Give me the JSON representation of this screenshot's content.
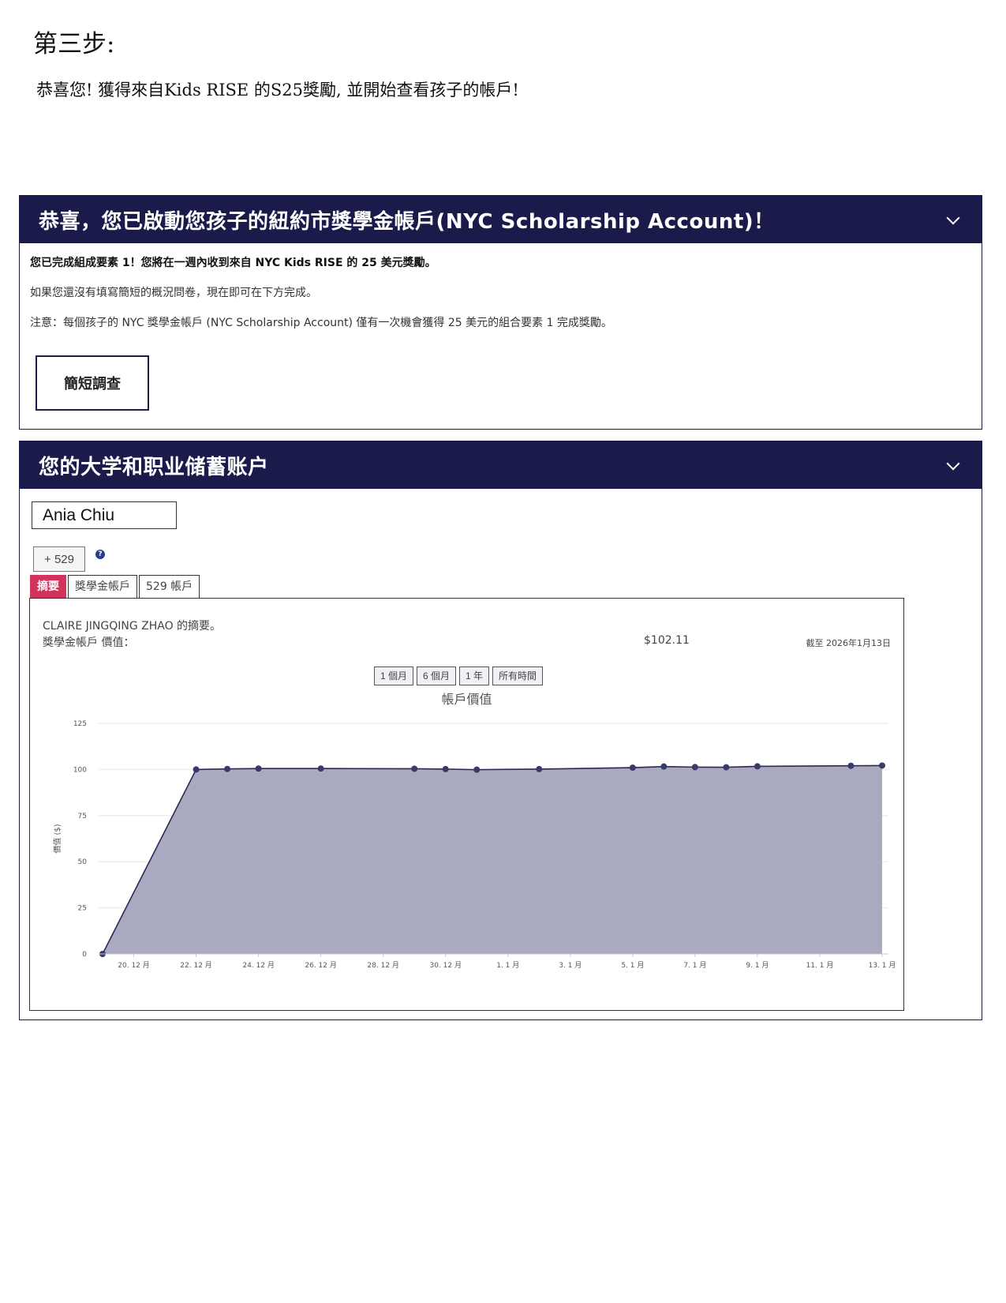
{
  "page": {
    "step_title": "第三步:",
    "step_desc": "恭喜您! 獲得來自Kids RISE 的S25獎勵, 並開始查看孩子的帳戶!"
  },
  "panel1": {
    "title": "恭喜，您已啟動您孩子的紐約市獎學金帳戶(NYC Scholarship Account)！",
    "line1": "您已完成組成要素 1！您將在一週內收到來自 NYC Kids RISE 的 25 美元獎勵。",
    "line2": "如果您還沒有填寫簡短的概況問卷，現在即可在下方完成。",
    "line3": "注意：每個孩子的 NYC 獎學金帳戶 (NYC Scholarship Account) 僅有一次機會獲得 25 美元的組合要素 1 完成獎勵。",
    "survey_button": "簡短調查"
  },
  "panel2": {
    "title": "您的大学和职业储蓄账户",
    "student_name": "Ania Chiu",
    "plan_button": "+ 529",
    "help_icon": "?",
    "tabs": [
      {
        "label": "摘要",
        "active": true
      },
      {
        "label": "獎學金帳戶",
        "active": false
      },
      {
        "label": "529 帳戶",
        "active": false
      }
    ],
    "summary": {
      "name_line": "CLAIRE JINGQING ZHAO 的摘要。",
      "value_label": "獎學金帳戶 價值：",
      "value": "$102.11",
      "as_of": "截至 2026年1月13日"
    },
    "ranges": [
      "1 個月",
      "6 個月",
      "1 年",
      "所有時間"
    ]
  },
  "chart_data": {
    "type": "area",
    "title": "帳戶價值",
    "ylabel": "價值 ($)",
    "xlabel": "",
    "ylim": [
      0,
      125
    ],
    "yticks": [
      0,
      25,
      50,
      75,
      100,
      125
    ],
    "x_tick_labels": [
      "20. 12 月",
      "22. 12 月",
      "24. 12 月",
      "26. 12 月",
      "28. 12 月",
      "30. 12 月",
      "1. 1 月",
      "3. 1 月",
      "5. 1 月",
      "7. 1 月",
      "9. 1 月",
      "11. 1 月",
      "13. 1 月"
    ],
    "x": [
      "2025-12-19",
      "2025-12-22",
      "2025-12-23",
      "2025-12-24",
      "2025-12-26",
      "2025-12-29",
      "2025-12-30",
      "2025-12-31",
      "2026-01-02",
      "2026-01-05",
      "2026-01-06",
      "2026-01-07",
      "2026-01-08",
      "2026-01-09",
      "2026-01-12",
      "2026-01-13"
    ],
    "values": [
      0,
      100,
      100.3,
      100.5,
      100.5,
      100.4,
      100.2,
      99.9,
      100.2,
      101,
      101.6,
      101.3,
      101.2,
      101.7,
      102.0,
      102.11
    ],
    "grid": true,
    "colors": {
      "line": "#2a2a55",
      "fill": "#a9a9bf",
      "point": "#3a3a6a"
    }
  }
}
